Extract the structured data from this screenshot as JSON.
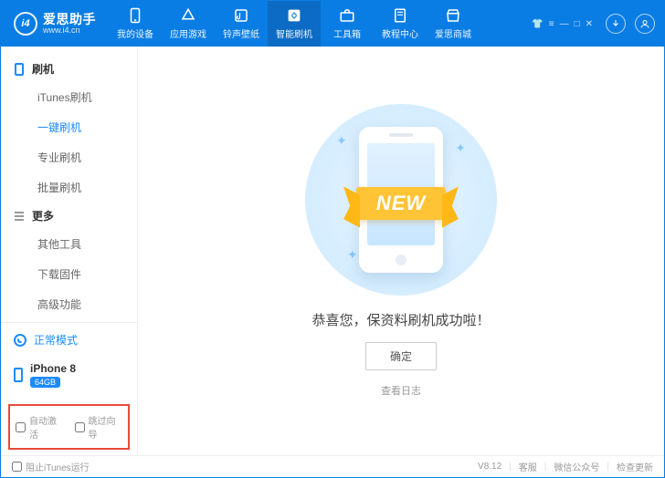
{
  "app": {
    "name": "爱思助手",
    "url": "www.i4.cn",
    "logo_text": "i4"
  },
  "top_tabs": [
    {
      "id": "device",
      "label": "我的设备"
    },
    {
      "id": "apps",
      "label": "应用游戏"
    },
    {
      "id": "ring",
      "label": "铃声壁纸"
    },
    {
      "id": "flash",
      "label": "智能刷机",
      "active": true
    },
    {
      "id": "toolbox",
      "label": "工具箱"
    },
    {
      "id": "tutorial",
      "label": "教程中心"
    },
    {
      "id": "mall",
      "label": "爱思商城"
    }
  ],
  "sidebar": {
    "sections": [
      {
        "title": "刷机",
        "icon": "phone",
        "items": [
          {
            "id": "itunes",
            "label": "iTunes刷机"
          },
          {
            "id": "onekey",
            "label": "一键刷机",
            "selected": true
          },
          {
            "id": "pro",
            "label": "专业刷机"
          },
          {
            "id": "batch",
            "label": "批量刷机"
          }
        ]
      },
      {
        "title": "更多",
        "icon": "burger",
        "items": [
          {
            "id": "other",
            "label": "其他工具"
          },
          {
            "id": "dl",
            "label": "下载固件"
          },
          {
            "id": "adv",
            "label": "高级功能"
          }
        ]
      }
    ],
    "mode_status": "正常模式",
    "device": {
      "name": "iPhone 8",
      "badge": "64GB"
    },
    "options": {
      "auto_activate": "自动激活",
      "skip_wizard": "跳过向导"
    }
  },
  "main": {
    "ribbon": "NEW",
    "message": "恭喜您，保资料刷机成功啦！",
    "ok": "确定",
    "log_link": "查看日志"
  },
  "statusbar": {
    "block_itunes": "阻止iTunes运行",
    "version": "V8.12",
    "support": "客服",
    "wechat": "微信公众号",
    "update": "检查更新"
  }
}
